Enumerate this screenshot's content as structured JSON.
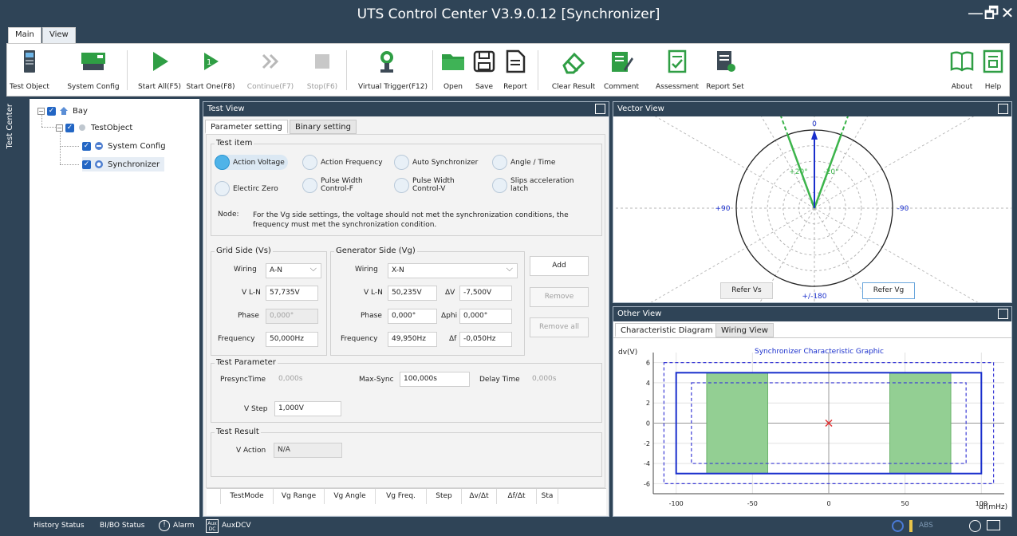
{
  "window": {
    "title": "UTS Control Center  V3.9.0.12 [Synchronizer]",
    "min": "—",
    "restore": "🗗",
    "close": "✕"
  },
  "menu_tabs": [
    "Main",
    "View"
  ],
  "toolbar": {
    "test_object": "Test Object",
    "system_config": "System Config",
    "start_all": "Start All(F5)",
    "start_one": "Start One(F8)",
    "continue": "Continue(F7)",
    "stop": "Stop(F6)",
    "virtual_trigger": "Virtual Trigger(F12)",
    "open": "Open",
    "save": "Save",
    "report": "Report",
    "clear_result": "Clear Result",
    "comment": "Comment",
    "assessment": "Assessment",
    "report_set": "Report Set",
    "about": "About",
    "help": "Help",
    "start_one_glyph": "1"
  },
  "rail": {
    "label": "Test Center"
  },
  "tree": {
    "expander_minus": "−",
    "check_mark": "✓",
    "bay": "Bay",
    "test_object": "TestObject",
    "system_config": "System Config",
    "synchronizer": "Synchronizer"
  },
  "test_view": {
    "title": "Test View",
    "tabs": [
      "Parameter setting",
      "Binary setting"
    ],
    "test_item": {
      "label": "Test item",
      "options": [
        "Action Voltage",
        "Action Frequency",
        "Auto Synchronizer",
        "Angle / Time",
        "Electirc Zero",
        "Pulse Width Control-F",
        "Pulse Width Control-V",
        "Slips acceleration latch"
      ],
      "selected_index": 0,
      "node_label": "Node:",
      "node_text": "For the Vg side settings, the voltage should not met the synchronization conditions, the frequency must met the synchronization condition."
    },
    "grid_side": {
      "label": "Grid Side (Vs)",
      "wiring_label": "Wiring",
      "wiring": "A-N",
      "vln_label": "V L-N",
      "vln": "57,735V",
      "phase_label": "Phase",
      "phase": "0,000°",
      "freq_label": "Frequency",
      "freq": "50,000Hz"
    },
    "gen_side": {
      "label": "Generator Side (Vg)",
      "wiring_label": "Wiring",
      "wiring": "X-N",
      "vln_label": "V L-N",
      "vln": "50,235V",
      "dv_label": "ΔV",
      "dv": "-7,500V",
      "phase_label": "Phase",
      "phase": "0,000°",
      "dphi_label": "Δphi",
      "dphi": "0,000°",
      "freq_label": "Frequency",
      "freq": "49,950Hz",
      "df_label": "Δf",
      "df": "-0,050Hz"
    },
    "buttons": {
      "add": "Add",
      "remove": "Remove",
      "remove_all": "Remove all"
    },
    "test_parameter": {
      "label": "Test Parameter",
      "presync_label": "PresyncTime",
      "presync": "0,000s",
      "maxsync_label": "Max-Sync",
      "maxsync": "100,000s",
      "delay_label": "Delay Time",
      "delay": "0,000s",
      "vstep_label": "V Step",
      "vstep": "1,000V"
    },
    "test_result": {
      "label": "Test Result",
      "vaction_label": "V Action",
      "vaction": "N/A"
    },
    "table_headers": [
      "",
      "TestMode",
      "Vg Range",
      "Vg Angle",
      "Vg Freq.",
      "Step",
      "Δv/Δt",
      "Δf/Δt",
      "Sta"
    ]
  },
  "vector_view": {
    "title": "Vector View",
    "labels": {
      "top": "0",
      "left": "+90",
      "right": "-90",
      "bottom": "+/-180",
      "l20": "+20°",
      "r20": "-20°"
    },
    "refer_vs": "Refer Vs",
    "refer_vg": "Refer Vg",
    "vg_angle_deg": 0,
    "sector_half_angle_deg": 20
  },
  "other_view": {
    "title": "Other View",
    "tabs": [
      "Characteristic Diagram",
      "Wiring View"
    ],
    "chart_title": "Synchronizer Characteristic Graphic",
    "ylabel": "dv(V)",
    "xlabel": "df(mHz)",
    "x_ticks": [
      "-100",
      "-50",
      "0",
      "50",
      "100"
    ],
    "y_ticks": [
      "6",
      "4",
      "2",
      "0",
      "-2",
      "-4",
      "-6"
    ]
  },
  "chart_data": {
    "type": "area",
    "title": "Synchronizer Characteristic Graphic",
    "xlabel": "df(mHz)",
    "ylabel": "dv(V)",
    "xlim": [
      -115,
      115
    ],
    "ylim": [
      -7,
      7
    ],
    "grid": true,
    "outer_dashed_rect": {
      "x": [
        -108,
        108
      ],
      "y": [
        -6,
        6
      ]
    },
    "solid_rect": {
      "x": [
        -100,
        100
      ],
      "y": [
        -5,
        5
      ]
    },
    "inner_dashed_rect": {
      "x": [
        -90,
        90
      ],
      "y": [
        -4,
        4
      ]
    },
    "green_zones": [
      {
        "x": [
          -80,
          -40
        ],
        "y": [
          -5,
          5
        ]
      },
      {
        "x": [
          40,
          80
        ],
        "y": [
          -5,
          5
        ]
      }
    ],
    "test_point": {
      "x": 0,
      "y": 0
    }
  },
  "status_bar": {
    "history": "History Status",
    "bibo": "BI/BO Status",
    "alarm": "Alarm",
    "auxdc_badge": "Aux DC",
    "auxdcv": "AuxDCV",
    "abs": "ABS"
  },
  "colors": {
    "accent": "#2f4457",
    "green": "#3cb44b",
    "blue": "#1a2fcc"
  }
}
